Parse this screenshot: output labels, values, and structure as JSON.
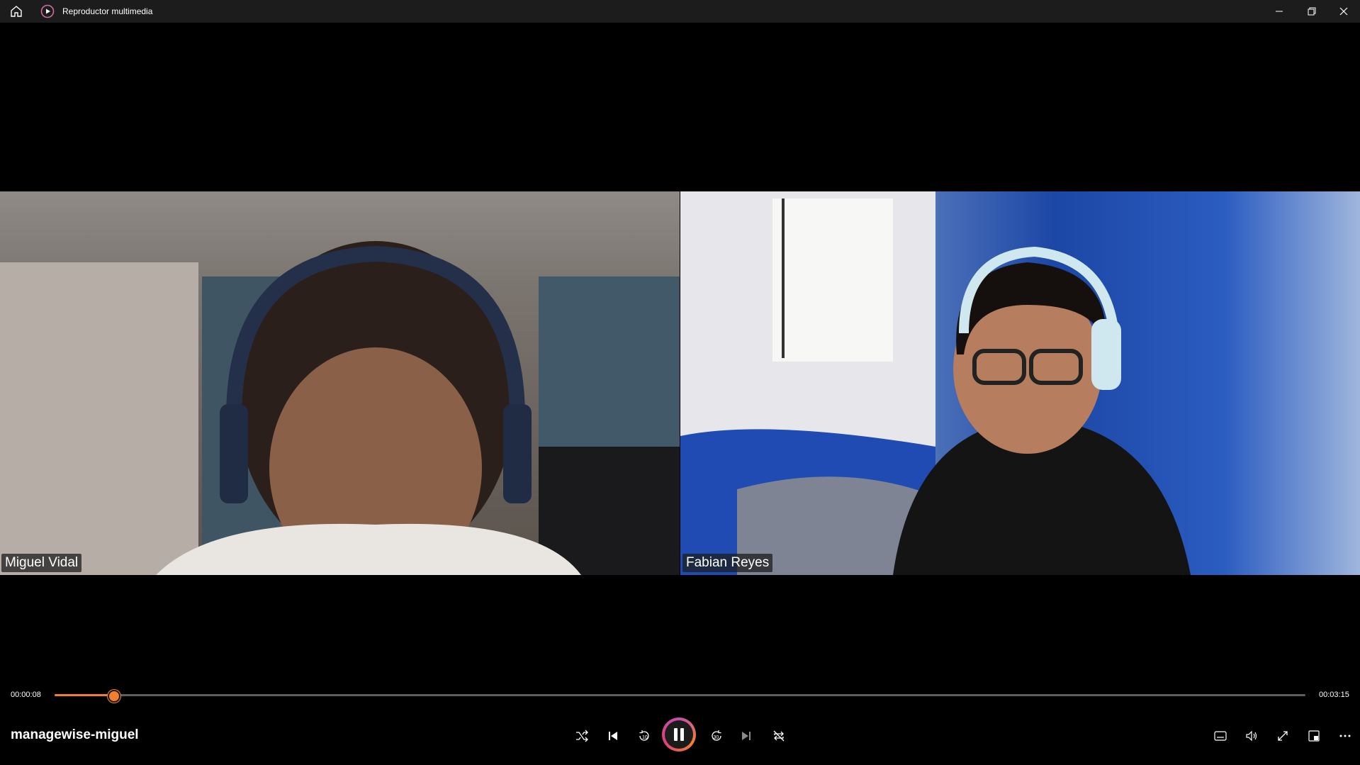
{
  "window": {
    "title": "Reproductor multimedia",
    "home_icon": "home-icon",
    "app_icon": "media-player-icon",
    "controls": [
      "minimize-icon",
      "restore-icon",
      "close-icon"
    ]
  },
  "video": {
    "participants": [
      {
        "name": "Miguel Vidal"
      },
      {
        "name": "Fabian Reyes"
      }
    ]
  },
  "playback": {
    "current_time": "00:00:08",
    "total_time": "00:03:15",
    "progress_fraction": 0.047,
    "accent_color": "#f08030"
  },
  "controls": {
    "file_name": "managewise-miguel",
    "buttons": [
      "shuffle-icon",
      "previous-icon",
      "rewind-10-icon",
      "pause-icon",
      "forward-30-icon",
      "next-icon",
      "repeat-icon"
    ],
    "right_buttons": [
      "captions-icon",
      "volume-icon",
      "fullscreen-icon",
      "mini-player-icon",
      "more-options-icon"
    ]
  }
}
